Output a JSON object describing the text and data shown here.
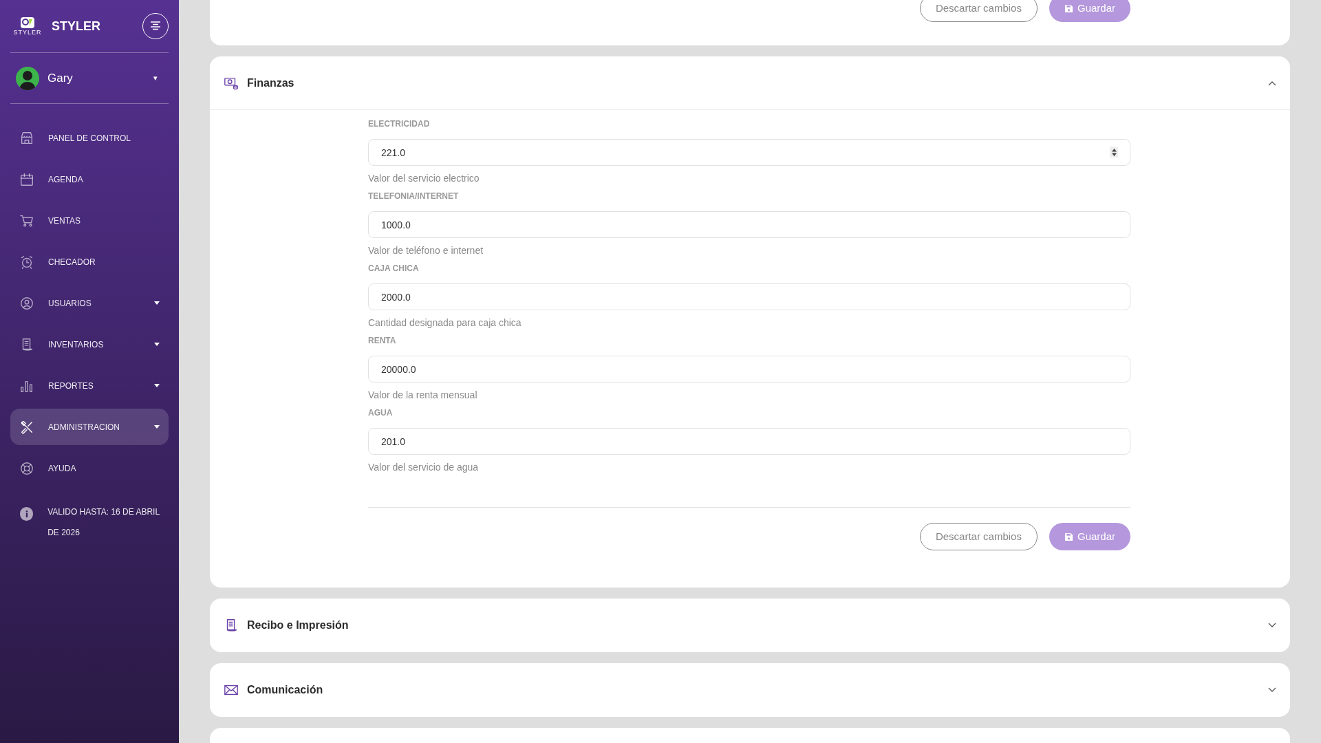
{
  "sidebar": {
    "brand": {
      "logo_text": "STYLER",
      "title": "STYLER"
    },
    "user": {
      "name": "Gary",
      "caret": "▾"
    },
    "items": [
      {
        "label": "PANEL DE CONTROL",
        "selected": false,
        "has_submenu": false
      },
      {
        "label": "AGENDA",
        "selected": false,
        "has_submenu": false
      },
      {
        "label": "VENTAS",
        "selected": false,
        "has_submenu": false
      },
      {
        "label": "CHECADOR",
        "selected": false,
        "has_submenu": false
      },
      {
        "label": "USUARIOS",
        "selected": false,
        "has_submenu": true
      },
      {
        "label": "INVENTARIOS",
        "selected": false,
        "has_submenu": true
      },
      {
        "label": "REPORTES",
        "selected": false,
        "has_submenu": true
      },
      {
        "label": "ADMINISTRACION",
        "selected": true,
        "has_submenu": true
      },
      {
        "label": "AYUDA",
        "selected": false,
        "has_submenu": false
      }
    ],
    "validity": "VALIDO HASTA: 16 DE ABRIL DE 2026"
  },
  "top_card": {
    "buttons": [
      "Descartar cambios",
      "Guardar"
    ]
  },
  "sections": [
    {
      "title": "Finanzas",
      "expanded": true,
      "fields": [
        {
          "label": "ELECTRICIDAD",
          "value": "221.0",
          "help": "Valor del servicio electrico",
          "stepper": true
        },
        {
          "label": "TELEFONIA/INTERNET",
          "value": "1000.0",
          "help": "Valor de teléfono e internet",
          "stepper": false
        },
        {
          "label": "CAJA CHICA",
          "value": "2000.0",
          "help": "Cantidad designada para caja chica",
          "stepper": false
        },
        {
          "label": "RENTA",
          "value": "20000.0",
          "help": "Valor de la renta mensual",
          "stepper": false
        },
        {
          "label": "AGUA",
          "value": "201.0",
          "help": "Valor del servicio de agua",
          "stepper": false
        }
      ],
      "buttons": [
        "Descartar cambios",
        "Guardar"
      ]
    },
    {
      "title": "Recibo e Impresión",
      "expanded": false
    },
    {
      "title": "Comunicación",
      "expanded": false
    }
  ]
}
